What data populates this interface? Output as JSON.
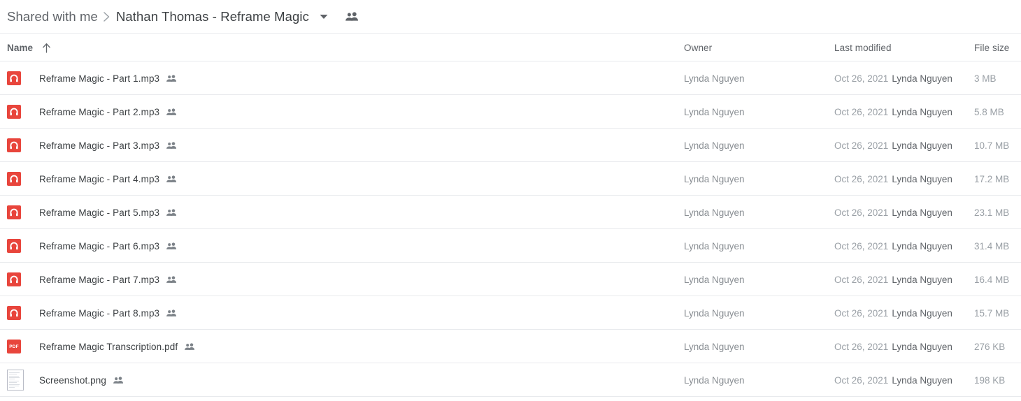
{
  "breadcrumb": {
    "root_label": "Shared with me",
    "separator_icon": "chevron-right-icon",
    "current_label": "Nathan Thomas - Reframe Magic",
    "caret_icon": "chevron-down-icon",
    "share_icon": "people-shared-icon"
  },
  "columns": {
    "name": "Name",
    "sort_icon": "arrow-up-icon",
    "owner": "Owner",
    "modified": "Last modified",
    "size": "File size"
  },
  "colors": {
    "accent_red": "#e8453c",
    "text_primary": "#3c4043",
    "text_secondary": "#5f6368",
    "text_muted": "#9aa0a6",
    "divider": "#e8eaed"
  },
  "files": [
    {
      "name": "Reframe Magic - Part 1.mp3",
      "icon": "audio-file-icon",
      "shared_icon": "people-shared-icon",
      "owner": "Lynda Nguyen",
      "modified_date": "Oct 26, 2021",
      "modified_by": "Lynda Nguyen",
      "size": "3 MB"
    },
    {
      "name": "Reframe Magic - Part 2.mp3",
      "icon": "audio-file-icon",
      "shared_icon": "people-shared-icon",
      "owner": "Lynda Nguyen",
      "modified_date": "Oct 26, 2021",
      "modified_by": "Lynda Nguyen",
      "size": "5.8 MB"
    },
    {
      "name": "Reframe Magic - Part 3.mp3",
      "icon": "audio-file-icon",
      "shared_icon": "people-shared-icon",
      "owner": "Lynda Nguyen",
      "modified_date": "Oct 26, 2021",
      "modified_by": "Lynda Nguyen",
      "size": "10.7 MB"
    },
    {
      "name": "Reframe Magic - Part 4.mp3",
      "icon": "audio-file-icon",
      "shared_icon": "people-shared-icon",
      "owner": "Lynda Nguyen",
      "modified_date": "Oct 26, 2021",
      "modified_by": "Lynda Nguyen",
      "size": "17.2 MB"
    },
    {
      "name": "Reframe Magic - Part 5.mp3",
      "icon": "audio-file-icon",
      "shared_icon": "people-shared-icon",
      "owner": "Lynda Nguyen",
      "modified_date": "Oct 26, 2021",
      "modified_by": "Lynda Nguyen",
      "size": "23.1 MB"
    },
    {
      "name": "Reframe Magic - Part 6.mp3",
      "icon": "audio-file-icon",
      "shared_icon": "people-shared-icon",
      "owner": "Lynda Nguyen",
      "modified_date": "Oct 26, 2021",
      "modified_by": "Lynda Nguyen",
      "size": "31.4 MB"
    },
    {
      "name": "Reframe Magic - Part 7.mp3",
      "icon": "audio-file-icon",
      "shared_icon": "people-shared-icon",
      "owner": "Lynda Nguyen",
      "modified_date": "Oct 26, 2021",
      "modified_by": "Lynda Nguyen",
      "size": "16.4 MB"
    },
    {
      "name": "Reframe Magic - Part 8.mp3",
      "icon": "audio-file-icon",
      "shared_icon": "people-shared-icon",
      "owner": "Lynda Nguyen",
      "modified_date": "Oct 26, 2021",
      "modified_by": "Lynda Nguyen",
      "size": "15.7 MB"
    },
    {
      "name": "Reframe Magic Transcription.pdf",
      "icon": "pdf-file-icon",
      "icon_label": "PDF",
      "shared_icon": "people-shared-icon",
      "owner": "Lynda Nguyen",
      "modified_date": "Oct 26, 2021",
      "modified_by": "Lynda Nguyen",
      "size": "276 KB"
    },
    {
      "name": "Screenshot.png",
      "icon": "image-file-icon",
      "shared_icon": "people-shared-icon",
      "owner": "Lynda Nguyen",
      "modified_date": "Oct 26, 2021",
      "modified_by": "Lynda Nguyen",
      "size": "198 KB"
    }
  ]
}
